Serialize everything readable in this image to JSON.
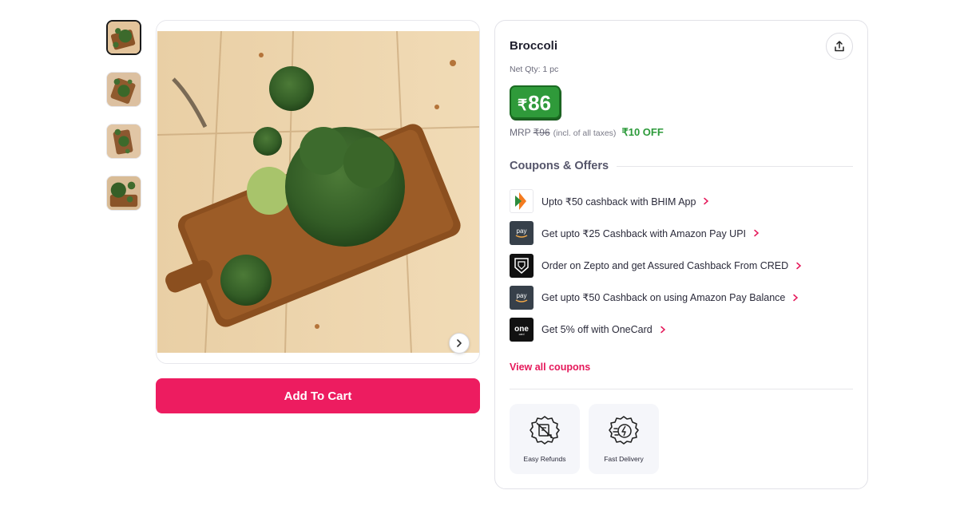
{
  "gallery": {
    "thumbnails": [
      {
        "label": "",
        "active": true
      },
      {
        "label": "",
        "active": false
      },
      {
        "label": "",
        "active": false
      },
      {
        "label": "",
        "active": false
      }
    ]
  },
  "actions": {
    "add_to_cart_label": "Add To Cart"
  },
  "product": {
    "name": "Broccoli",
    "net_qty": "Net Qty: 1 pc",
    "price_symbol": "₹",
    "price": "86",
    "mrp_label": "MRP",
    "mrp_value": "₹96",
    "tax_note": "(incl. of all taxes)",
    "discount": "₹10 OFF"
  },
  "coupons": {
    "title": "Coupons & Offers",
    "offers": [
      {
        "text": "Upto ₹50 cashback with BHIM App",
        "icon": "bhim-logo-icon"
      },
      {
        "text": "Get upto ₹25 Cashback with Amazon Pay UPI",
        "icon": "amazon-pay-logo-icon"
      },
      {
        "text": "Order on Zepto and get Assured Cashback From CRED",
        "icon": "cred-logo-icon"
      },
      {
        "text": "Get upto ₹50 Cashback on using Amazon Pay Balance",
        "icon": "amazon-pay-logo-icon"
      },
      {
        "text": "Get 5% off with OneCard",
        "icon": "onecard-logo-icon"
      }
    ],
    "view_all_label": "View all coupons"
  },
  "features": [
    {
      "label": "Easy Refunds",
      "icon": "refund-icon"
    },
    {
      "label": "Fast Delivery",
      "icon": "fast-delivery-icon"
    }
  ],
  "colors": {
    "accent": "#ed1c60",
    "price_green": "#2f9a3a",
    "discount_green": "#2c9a3a",
    "link_pink": "#e5185a"
  }
}
